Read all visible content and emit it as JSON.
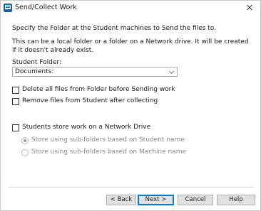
{
  "window": {
    "title": "Send/Collect Work",
    "icon": "app-icon",
    "close_icon": "close-icon"
  },
  "content": {
    "intro": "Specify the Folder at the Student machines to Send the files to.",
    "description": "This can be a local folder or a folder on a Network drive. It will be created if it doesn't already exist.",
    "folder_label": "Student Folder:",
    "folder_value": "Documents:",
    "folder_chevron": "chevron-down-icon"
  },
  "options": {
    "delete_files": {
      "label": "Delete all files from Folder before Sending work",
      "checked": false
    },
    "remove_files": {
      "label": "Remove files from Student after collecting",
      "checked": false
    },
    "network_drive": {
      "label": "Students store work on a Network Drive",
      "checked": false
    }
  },
  "network_options": [
    {
      "label": "Store using sub-folders based on Student name",
      "selected": true,
      "enabled": false
    },
    {
      "label": "Store using sub-folders based on Machine name",
      "selected": false,
      "enabled": false
    }
  ],
  "buttons": {
    "back": "< Back",
    "next": "Next >",
    "cancel": "Cancel",
    "help": "Help"
  },
  "colors": {
    "accent": "#0078d7",
    "button_face": "#e1e1e1",
    "disabled_text": "#8a8a8a"
  }
}
